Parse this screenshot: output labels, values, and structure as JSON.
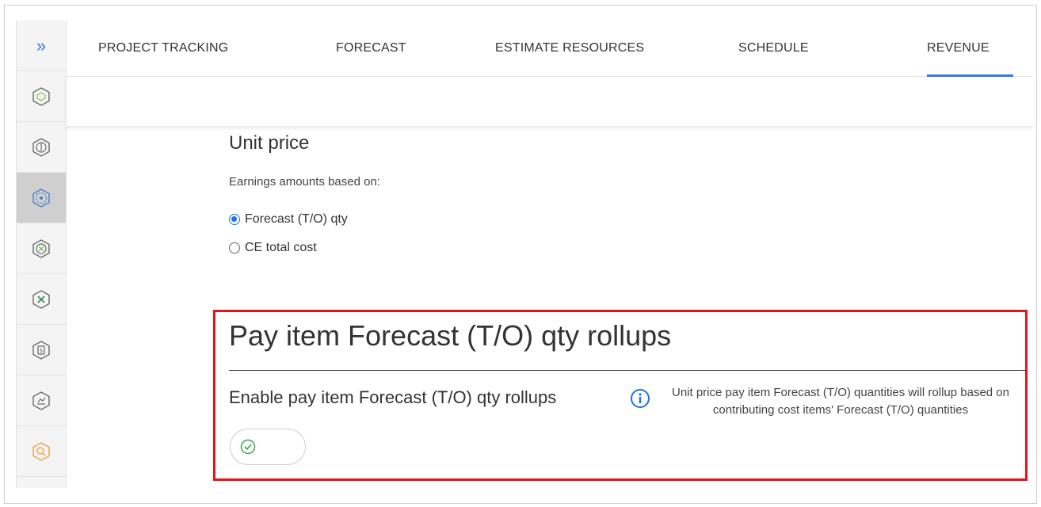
{
  "tabs": [
    {
      "label": "PROJECT TRACKING"
    },
    {
      "label": "FORECAST"
    },
    {
      "label": "ESTIMATE RESOURCES"
    },
    {
      "label": "SCHEDULE"
    },
    {
      "label": "REVENUE"
    }
  ],
  "active_tab": "REVENUE",
  "rail": {
    "expand_icon": "double-chevron-right-icon",
    "items": [
      {
        "icon": "module-icon"
      },
      {
        "icon": "tracking-icon"
      },
      {
        "icon": "forecast-icon"
      },
      {
        "icon": "resources-icon"
      },
      {
        "icon": "schedule-icon"
      },
      {
        "icon": "revenue-icon"
      },
      {
        "icon": "analysis-icon"
      },
      {
        "icon": "search-module-icon"
      }
    ]
  },
  "unit_price": {
    "title": "Unit price",
    "earnings_label": "Earnings amounts based on:",
    "options": [
      {
        "label": "Forecast (T/O) qty",
        "checked": true
      },
      {
        "label": "CE total cost",
        "checked": false
      }
    ]
  },
  "rollups": {
    "title": "Pay item Forecast (T/O) qty rollups",
    "enable_label": "Enable pay item Forecast (T/O) qty rollups",
    "description": "Unit price pay item Forecast (T/O) quantities will rollup based on contributing cost items' Forecast (T/O) quantities",
    "toggle_on": true
  },
  "colors": {
    "accent": "#2f7de1",
    "highlight": "#e3141b",
    "toggle_check": "#3aa64b",
    "rail_last_icon": "#f0a040"
  }
}
